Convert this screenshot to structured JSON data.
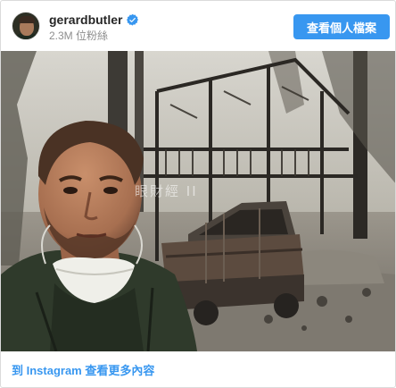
{
  "header": {
    "username": "gerardbutler",
    "followers": "2.3M 位粉絲",
    "view_profile_label": "查看個人檔案"
  },
  "photo": {
    "watermark": "眼財經 II"
  },
  "footer": {
    "more_link": "到 Instagram 查看更多內容"
  },
  "colors": {
    "accent": "#3897f0",
    "verified": "#3897f0"
  },
  "icons": [
    "verified-badge-icon"
  ]
}
